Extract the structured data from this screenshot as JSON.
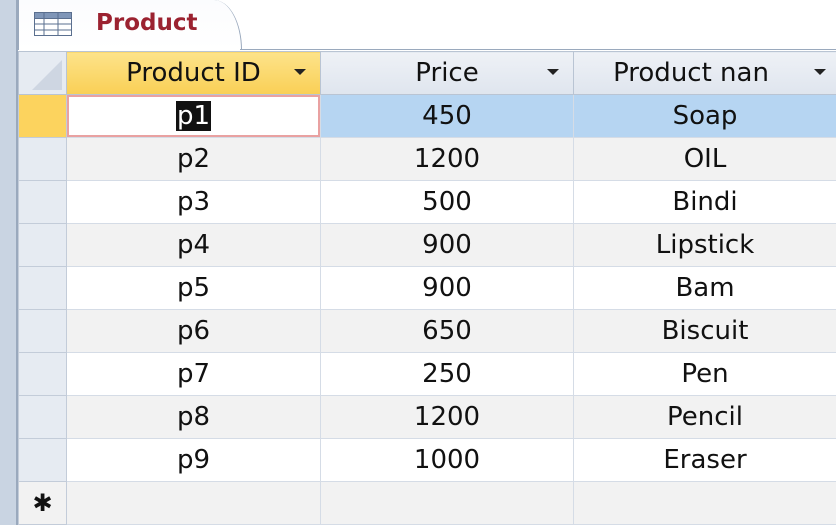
{
  "tab": {
    "label": "Product",
    "icon": "table-icon"
  },
  "columns": [
    {
      "label": "Product ID",
      "active": true
    },
    {
      "label": "Price",
      "active": false
    },
    {
      "label": "Product nan",
      "active": false
    }
  ],
  "rows": [
    {
      "product_id": "p1",
      "price": "450",
      "product_name": "Soap"
    },
    {
      "product_id": "p2",
      "price": "1200",
      "product_name": "OIL"
    },
    {
      "product_id": "p3",
      "price": "500",
      "product_name": "Bindi"
    },
    {
      "product_id": "p4",
      "price": "900",
      "product_name": "Lipstick"
    },
    {
      "product_id": "p5",
      "price": "900",
      "product_name": "Bam"
    },
    {
      "product_id": "p6",
      "price": "650",
      "product_name": "Biscuit"
    },
    {
      "product_id": "p7",
      "price": "250",
      "product_name": "Pen"
    },
    {
      "product_id": "p8",
      "price": "1200",
      "product_name": "Pencil"
    },
    {
      "product_id": "p9",
      "price": "1000",
      "product_name": "Eraser"
    }
  ],
  "new_row_marker": "✱",
  "colors": {
    "tab_label": "#9b2230",
    "active_header": "#f9cf55",
    "selected_row": "#b6d5f2",
    "current_selector": "#fcd35e"
  }
}
